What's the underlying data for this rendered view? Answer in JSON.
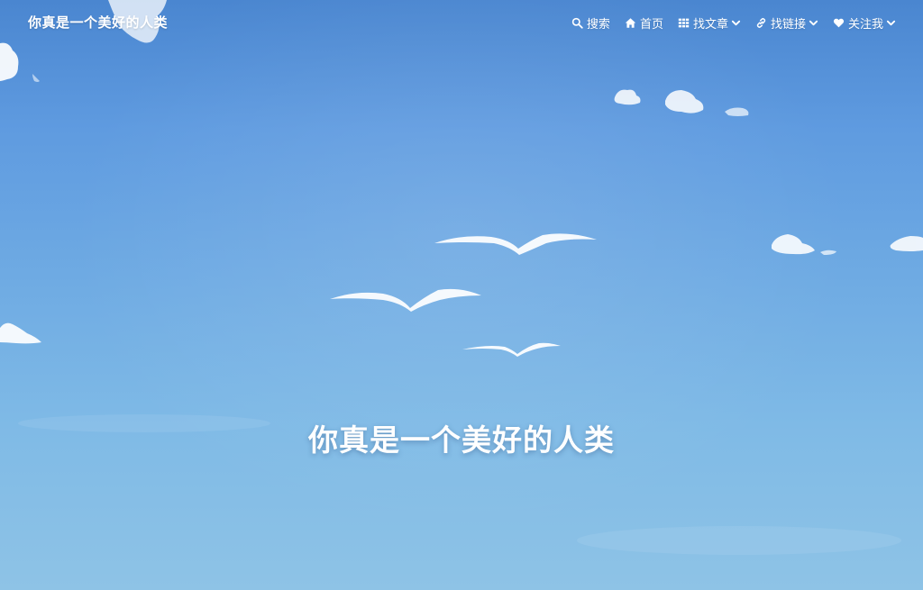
{
  "site": {
    "brand": "你真是一个美好的人类"
  },
  "nav": {
    "items": [
      {
        "label": "搜索",
        "icon": "search-icon",
        "has_dropdown": false
      },
      {
        "label": "首页",
        "icon": "home-icon",
        "has_dropdown": false
      },
      {
        "label": "找文章",
        "icon": "grid-icon",
        "has_dropdown": true
      },
      {
        "label": "找链接",
        "icon": "link-icon",
        "has_dropdown": true
      },
      {
        "label": "关注我",
        "icon": "heart-icon",
        "has_dropdown": true
      }
    ]
  },
  "hero": {
    "title": "你真是一个美好的人类"
  },
  "colors": {
    "sky_top": "#4a86d0",
    "sky_bottom": "#8ec3e6",
    "text": "#ffffff"
  }
}
